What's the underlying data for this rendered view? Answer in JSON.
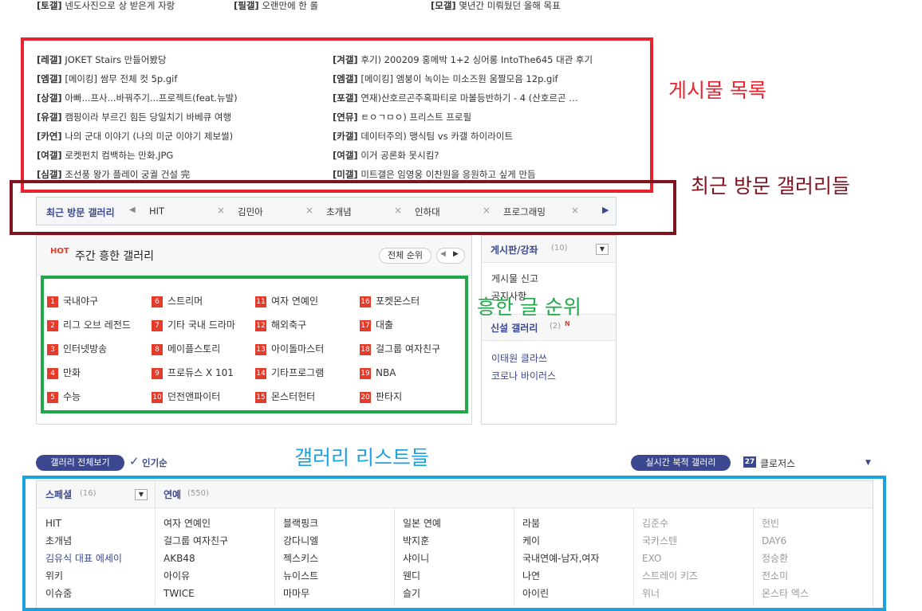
{
  "top_partial": [
    {
      "tag": "[토갤]",
      "text": "넨도사진으로 상 받은게 자랑"
    },
    {
      "tag": "[필갤]",
      "text": "오랜만에 한 롤"
    },
    {
      "tag": "[모갤]",
      "text": "몇년간 미뤄뒀던 올해 목표"
    }
  ],
  "posts_left": [
    {
      "tag": "[레갤]",
      "text": "JOKET Stairs 만들어봤당"
    },
    {
      "tag": "[엠갤]",
      "text": "[메이킹] 쌈무 전체 컷 5p.gif"
    },
    {
      "tag": "[상갤]",
      "text": "아빠...프사...바꿔주기...프로젝트(feat.뉴발)"
    },
    {
      "tag": "[유갤]",
      "text": "캠핑이라 부르긴 힘든 당일치기 바베큐 여행"
    },
    {
      "tag": "[카연]",
      "text": "나의 군대 이야기 (나의 미군 이야기 제보썰)"
    },
    {
      "tag": "[여갤]",
      "text": "로켓펀치 컴백하는 만화.JPG"
    },
    {
      "tag": "[심갤]",
      "text": "조선풍 왕가 플레이 궁궐 건설 完"
    }
  ],
  "posts_right": [
    {
      "tag": "[겨갤]",
      "text": "후기) 200209 홍메박 1+2 싱어롱 IntoThe645 대관 후기"
    },
    {
      "tag": "[엠갤]",
      "text": "[메이킹] 엠붕이 녹이는 미소즈원 움짤모음 12p.gif"
    },
    {
      "tag": "[포갤]",
      "text": "연재)산호르곤주혹파티로 마볼등반하기 - 4 (산호르곤 …"
    },
    {
      "tag": "[연뮤]",
      "text": "ㅌㅇㄱㅁㅇ) 프리스트 프로필"
    },
    {
      "tag": "[카갤]",
      "text": "데이터주의) 맹식팀 vs 카갤 하이라이트"
    },
    {
      "tag": "[여갤]",
      "text": "이거 공론화 못시킴?"
    },
    {
      "tag": "[미갤]",
      "text": "미트갤은 임영웅 이찬원을 응원하고 싶게 만듬"
    }
  ],
  "annotations": {
    "posts": "게시물 목록",
    "recent": "최근 방문 갤러리들",
    "hot": "흥한 글 순위",
    "lists": "갤러리 리스트들"
  },
  "recent": {
    "title": "최근 방문 갤러리",
    "items": [
      "HIT",
      "김민아",
      "초개념",
      "인하대",
      "프로그래밍"
    ],
    "close_glyph": "×"
  },
  "hot": {
    "badge": "HOT",
    "title": "주간 흥한 갤러리",
    "rank_button": "전체 순위",
    "items": [
      [
        "1",
        "국내야구"
      ],
      [
        "2",
        "리그 오브 레전드"
      ],
      [
        "3",
        "인터넷방송"
      ],
      [
        "4",
        "만화"
      ],
      [
        "5",
        "수능"
      ],
      [
        "6",
        "스트리머"
      ],
      [
        "7",
        "기타 국내 드라마"
      ],
      [
        "8",
        "메이플스토리"
      ],
      [
        "9",
        "프로듀스 X 101"
      ],
      [
        "10",
        "던전앤파이터"
      ],
      [
        "11",
        "여자 연예인"
      ],
      [
        "12",
        "해외축구"
      ],
      [
        "13",
        "아이돌마스터"
      ],
      [
        "14",
        "기타프로그램"
      ],
      [
        "15",
        "몬스터헌터"
      ],
      [
        "16",
        "포켓몬스터"
      ],
      [
        "17",
        "대출"
      ],
      [
        "18",
        "걸그룹 여자친구"
      ],
      [
        "19",
        "NBA"
      ],
      [
        "20",
        "판타지"
      ]
    ]
  },
  "side": {
    "board_title": "게시판/강좌",
    "board_count": "(10)",
    "board_items": [
      "게시물 신고",
      "공지사항"
    ],
    "new_title": "신설 갤러리",
    "new_count": "(2)",
    "new_badge": "N",
    "new_items": [
      "이태원 클라쓰",
      "코로나 바이러스"
    ]
  },
  "list_toolbar": {
    "all_button": "갤러리 전체보기",
    "popular": "인기순",
    "realtime_button": "실시간 북적 갤러리",
    "rt_rank": "27",
    "rt_name": "클로저스"
  },
  "lists": {
    "special_title": "스페셜",
    "special_count": "(16)",
    "ent_title": "연예",
    "ent_count": "(550)",
    "special_items": [
      "HIT",
      "초개념",
      "김유식 대표 에세이",
      "위키",
      "이슈줌"
    ],
    "ent_cols": [
      [
        "여자 연예인",
        "걸그룹 여자친구",
        "AKB48",
        "아이유",
        "TWICE"
      ],
      [
        "블랙핑크",
        "강다니엘",
        "젝스키스",
        "뉴이스트",
        "마마무"
      ],
      [
        "일본 연예",
        "박지훈",
        "샤이니",
        "웬디",
        "슬기"
      ],
      [
        "라붐",
        "케이",
        "국내연예-남자,여자",
        "나연",
        "아이린"
      ],
      [
        "김준수",
        "국카스텐",
        "EXO",
        "스트레이 키즈",
        "위너"
      ],
      [
        "현빈",
        "DAY6",
        "정승환",
        "전소미",
        "몬스타 엑스"
      ]
    ]
  },
  "colors": {
    "red_box": "#e8232e",
    "maroon_box": "#7d1420",
    "green_box": "#22a84a",
    "blue_box": "#1aa3e0",
    "navy": "#3b4890",
    "hot_red": "#e63a2a"
  }
}
